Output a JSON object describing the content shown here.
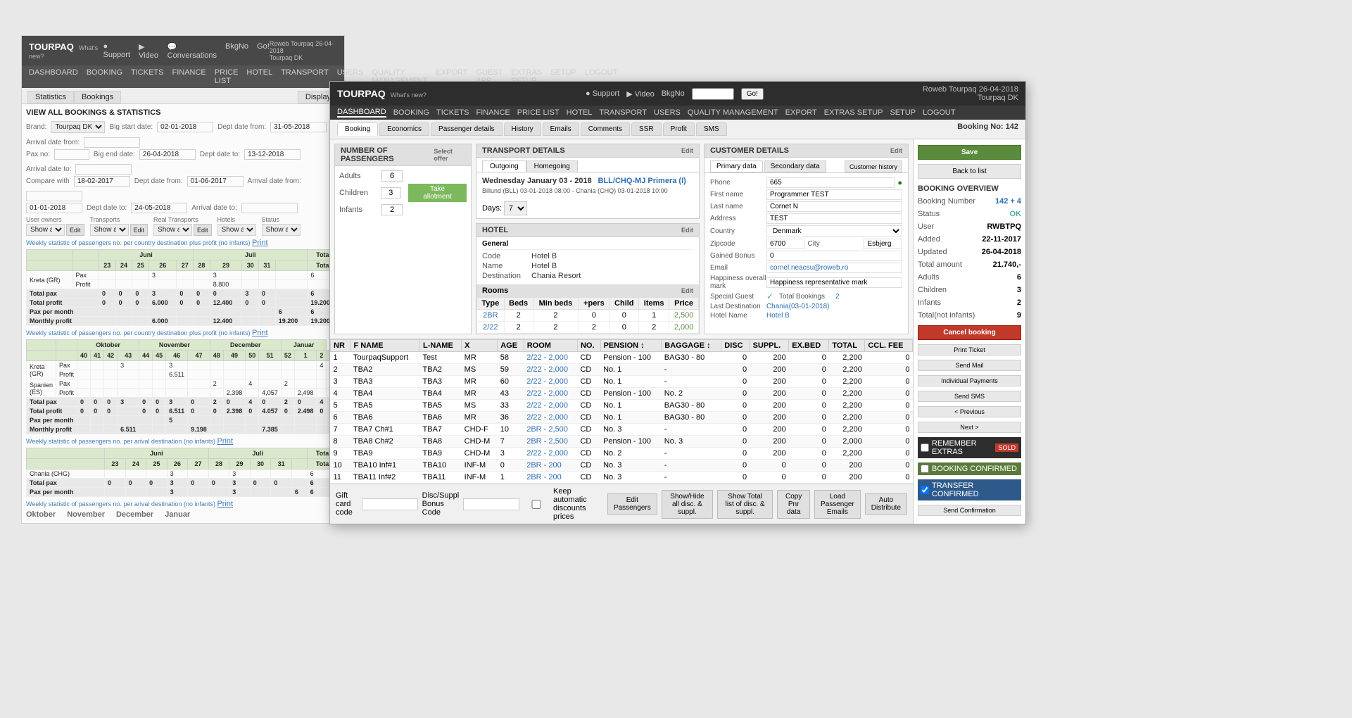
{
  "background_window": {
    "brand": "TOURPAQ",
    "brand_sub": "What's new?",
    "nav_items": [
      "DASHBOARD",
      "BOOKING",
      "TICKETS",
      "FINANCE",
      "PRICE LIST",
      "HOTEL",
      "TRANSPORT",
      "USERS",
      "QUALITY MANAGEMENT",
      "EXPORT",
      "GUEST APP",
      "EXTRAS SETUP",
      "SETUP",
      "LOGOUT"
    ],
    "title": "VIEW ALL BOOKINGS & STATISTICS",
    "tab_statistics": "Statistics",
    "tab_bookings": "Bookings",
    "tab_display": "Display",
    "filters": {
      "brand_label": "Brand",
      "brand_val": "Tourpaq DK",
      "pax_label": "Pax no:",
      "big_start_label": "Big start date:",
      "big_start_val": "02-01-2018",
      "dept_date_from_label": "Dept date from:",
      "dept_date_from_val": "31-05-2018",
      "arrival_date_from_label": "Arrival date from:",
      "big_end_label": "Big end date:",
      "big_end_val": "26-04-2018",
      "dept_date_to_label": "Dept date to:",
      "dept_date_to_val": "13-12-2018",
      "arrival_date_to_label": "Arrival date to:",
      "compare_label": "Compare with",
      "big_start2_val": "18-02-2017",
      "dept_date_from2_val": "01-06-2017",
      "arrival_date_from2_label": "Arrival date from:",
      "big_end2_val": "01-01-2018",
      "dept_date_to2_val": "24-05-2018",
      "arrival_date_to2_label": "Arrival date to:"
    },
    "sections": {
      "user_owners": "User owners",
      "transports": "Transports",
      "real_transports": "Real Transports",
      "hotels": "Hotels",
      "status": "Status"
    },
    "weekly_stat_1": "Weekly statistic of passengers no. per country destination plus profit (no infants) Print",
    "monthly_table_1": {
      "months": [
        "Juni",
        "Juli"
      ],
      "cols": [
        "23",
        "24",
        "25",
        "26",
        "27",
        "28",
        "29",
        "30",
        "31",
        "Total"
      ],
      "rows": [
        {
          "label": "Kreta (GR)",
          "type": "Pax",
          "values": [
            "",
            "",
            "",
            "3",
            "",
            "",
            "3",
            "",
            "",
            "6"
          ]
        },
        {
          "label": "",
          "type": "Profit",
          "values": [
            "",
            "",
            "",
            "",
            "",
            "",
            "8.800",
            "",
            "",
            ""
          ]
        },
        {
          "label": "Total pax",
          "values": [
            "0",
            "0",
            "0",
            "3",
            "0",
            "0",
            "0",
            "3",
            "0",
            "6"
          ]
        },
        {
          "label": "Total profit",
          "values": [
            "0",
            "0",
            "0",
            "6.000",
            "0",
            "0",
            "12.400",
            "0",
            "0",
            "19.200"
          ]
        },
        {
          "label": "Pax per month",
          "values": [
            "",
            "",
            "",
            "",
            "",
            "",
            "",
            "",
            "",
            "6"
          ]
        },
        {
          "label": "Monthly profit",
          "values": [
            "",
            "",
            "",
            "6.000",
            "",
            "",
            "12.400",
            "",
            "",
            "19.200"
          ]
        }
      ]
    },
    "weekly_stat_2": "Weekly statistic of passengers no. per country destination plus profit (no infants) Print",
    "monthly_table_2_months": [
      "Oktober",
      "November",
      "December",
      "Januar"
    ],
    "weekly_stat_3": "Weekly statistic of passengers no. per arival destination (no infants) Print"
  },
  "main_window": {
    "brand": "TOURPAQ",
    "brand_sub": "What's new?",
    "nav_items": [
      "DASHBOARD",
      "BOOKING",
      "TICKETS",
      "FINANCE",
      "PRICE LIST",
      "HOTEL",
      "TRANSPORT",
      "USERS",
      "QUALITY MANAGEMENT",
      "EXPORT",
      "EXTRAS SETUP",
      "SETUP",
      "LOGOUT"
    ],
    "user_info": "Roweb Tourpaq 26-04-2018",
    "user_company": "Tourpaq DK",
    "country": "Tourpaq DK",
    "search_placeholder": "Tourpaq DK",
    "booking_tabs": [
      "Booking",
      "Economics",
      "Passenger details",
      "History",
      "Emails",
      "Comments",
      "SSR",
      "Profit",
      "SMS"
    ],
    "booking_num_label": "Booking No: 142",
    "sections": {
      "number_of_passengers": "NUMBER OF PASSENGERS",
      "transport_details": "TRANSPORT DETAILS",
      "hotel": "HOTEL",
      "customer_details": "CUSTOMER DETAILS",
      "booking_overview": "BOOKING OVERVIEW"
    },
    "passengers": {
      "adults_label": "Adults",
      "adults_val": "6",
      "children_label": "Children",
      "children_val": "3",
      "infants_label": "Infants",
      "infants_val": "2",
      "take_allotment": "Take allotment"
    },
    "transport": {
      "tab_outgoing": "Outgoing",
      "tab_homegoing": "Homegoing",
      "route": "Wednesday January 03 - 2018",
      "route_code": "BLL/CHQ-MJ Primera (I)",
      "detail": "Billund (BLL) 03-01-2018 08:00 - Chania (CHQ) 03-01-2018 10:00",
      "days_label": "Days:",
      "days_val": "7"
    },
    "hotel": {
      "general_tab": "General",
      "code_label": "Code",
      "code_val": "Hotel B",
      "name_label": "Name",
      "name_val": "Hotel B",
      "destination_label": "Destination",
      "destination_val": "Chania Resort",
      "rooms_label": "Rooms",
      "rooms_cols": [
        "Type",
        "Beds",
        "Min beds",
        "+pers",
        "Child",
        "Items",
        "Price"
      ],
      "rooms_rows": [
        {
          "type": "2BR",
          "beds": "2",
          "min": "2",
          "plus": "0",
          "child": "0",
          "items": "1",
          "price": "2,500"
        },
        {
          "type": "2/22",
          "beds": "2",
          "min": "2",
          "plus": "2",
          "child": "0",
          "items": "2",
          "price": "2,000"
        }
      ]
    },
    "customer": {
      "tabs": [
        "Primary data",
        "Secondary data"
      ],
      "customer_history_btn": "Customer history",
      "phone_label": "Phone",
      "phone_val": "665",
      "first_name_label": "First name",
      "first_name_val": "Programmer TEST",
      "last_name_label": "Last name",
      "last_name_val": "Cornet N",
      "address_label": "Address",
      "address_val": "TEST",
      "country_label": "Country",
      "country_val": "Denmark",
      "zipcode_label": "Zipcode",
      "zipcode_val": "6700",
      "city_label": "City",
      "city_val": "Esbjerg",
      "gained_bonus_label": "Gained Bonus",
      "gained_bonus_val": "0",
      "email_label": "Email",
      "email_val": "cornel.neacsu@roweb.ro",
      "happiness_label": "Happiness overall mark",
      "happiness_val": "Happiness representative mark",
      "special_guest_label": "Special Guest",
      "special_guest_val": "✓",
      "total_bookings_label": "Total Bookings",
      "total_bookings_val": "2",
      "last_dest_label": "Last Destination",
      "last_dest_val": "Chania(03-01-2018)",
      "hotel_name_label": "Hotel Name",
      "hotel_name_val": "Hotel B"
    },
    "booking_overview": {
      "title": "BOOKING OVERVIEW",
      "booking_num_label": "Booking Number",
      "booking_num_val": "142 + 4",
      "status_label": "Status",
      "status_val": "OK",
      "user_label": "User",
      "user_val": "RWBTPQ",
      "added_label": "Added",
      "added_val": "22-11-2017",
      "updated_label": "Updated",
      "updated_val": "26-04-2018",
      "total_amount_label": "Total amount",
      "total_amount_val": "21.740,-",
      "adults_label": "Adults",
      "adults_val": "6",
      "children_label": "Children",
      "children_val": "3",
      "infants_label": "Infants",
      "infants_val": "2",
      "total_no_infants_label": "Total(not infants)",
      "total_no_infants_val": "9",
      "save_btn": "Save",
      "back_to_list_btn": "Back to list",
      "cancel_btn": "Cancel booking",
      "print_ticket_btn": "Print Ticket",
      "send_mail_btn": "Send Mail",
      "individual_payments_btn": "Individual Payments",
      "send_sms_btn": "Send SMS",
      "prev_btn": "< Previous",
      "next_btn": "Next >",
      "send_confirmation_btn": "Send Confirmation",
      "remember_extras_label": "REMEMBER EXTRAS",
      "remember_extras_sold": "SOLD",
      "booking_confirmed_label": "BOOKING CONFIRMED",
      "transfer_confirmed_label": "TRANSFER CONFIRMED"
    },
    "passenger_table": {
      "cols": [
        "NR",
        "F NAME",
        "L-NAME",
        "X",
        "AGE",
        "ROOM",
        "NO.",
        "PENSION",
        "BAGGAGE",
        "DISC",
        "SUPPL.",
        "EX.BED",
        "TOTAL",
        "CCL. FEE"
      ],
      "rows": [
        {
          "nr": "1",
          "fname": "TourpaqSupport",
          "lname": "Test",
          "x": "MR",
          "age": "58",
          "room": "2/22 - 2,000",
          "no": "CD",
          "pension": "Pension - 100",
          "baggage": "BAG30 - 80",
          "disc": "0",
          "suppl": "200",
          "exbed": "0",
          "total": "2,200",
          "ccl": "0"
        },
        {
          "nr": "2",
          "fname": "TBA2",
          "lname": "TBA2",
          "x": "MS",
          "age": "59",
          "room": "2/22 - 2,000",
          "no": "CD",
          "pension": "No. 1",
          "baggage": "-",
          "disc": "0",
          "suppl": "200",
          "exbed": "0",
          "total": "2,200",
          "ccl": "0"
        },
        {
          "nr": "3",
          "fname": "TBA3",
          "lname": "TBA3",
          "x": "MR",
          "age": "60",
          "room": "2/22 - 2,000",
          "no": "CD",
          "pension": "No. 1",
          "baggage": "-",
          "disc": "0",
          "suppl": "200",
          "exbed": "0",
          "total": "2,200",
          "ccl": "0"
        },
        {
          "nr": "4",
          "fname": "TBA4",
          "lname": "TBA4",
          "x": "MR",
          "age": "43",
          "room": "2/22 - 2,000",
          "no": "CD",
          "pension": "Pension - 100",
          "baggage": "No. 2",
          "disc": "0",
          "suppl": "200",
          "exbed": "0",
          "total": "2,200",
          "ccl": "0"
        },
        {
          "nr": "5",
          "fname": "TBA5",
          "lname": "TBA5",
          "x": "MS",
          "age": "33",
          "room": "2/22 - 2,000",
          "no": "CD",
          "pension": "No. 1",
          "baggage": "BAG30 - 80",
          "disc": "0",
          "suppl": "200",
          "exbed": "0",
          "total": "2,200",
          "ccl": "0"
        },
        {
          "nr": "6",
          "fname": "TBA6",
          "lname": "TBA6",
          "x": "MR",
          "age": "36",
          "room": "2/22 - 2,000",
          "no": "CD",
          "pension": "No. 1",
          "baggage": "BAG30 - 80",
          "disc": "0",
          "suppl": "200",
          "exbed": "0",
          "total": "2,200",
          "ccl": "0"
        },
        {
          "nr": "7",
          "fname": "TBA7 Ch#1",
          "lname": "TBA7",
          "x": "CHD-F",
          "age": "10",
          "room": "2BR - 2,500",
          "no": "CD",
          "pension": "No. 3",
          "baggage": "-",
          "disc": "0",
          "suppl": "200",
          "exbed": "0",
          "total": "2,200",
          "ccl": "0"
        },
        {
          "nr": "8",
          "fname": "TBA8 Ch#2",
          "lname": "TBA8",
          "x": "CHD-M",
          "age": "7",
          "room": "2BR - 2,500",
          "no": "CD",
          "pension": "Pension - 100",
          "baggage": "No. 3",
          "disc": "0",
          "suppl": "200",
          "exbed": "0",
          "total": "2,000",
          "ccl": "0"
        },
        {
          "nr": "9",
          "fname": "TBA9",
          "lname": "TBA9",
          "x": "CHD-M",
          "age": "3",
          "room": "2/22 - 2,000",
          "no": "CD",
          "pension": "No. 2",
          "baggage": "-",
          "disc": "0",
          "suppl": "200",
          "exbed": "0",
          "total": "2,200",
          "ccl": "0"
        },
        {
          "nr": "10",
          "fname": "TBA10 Inf#1",
          "lname": "TBA10",
          "x": "INF-M",
          "age": "0",
          "room": "2BR - 200",
          "no": "CD",
          "pension": "No. 3",
          "baggage": "-",
          "disc": "0",
          "suppl": "0",
          "exbed": "0",
          "total": "200",
          "ccl": "0"
        },
        {
          "nr": "11",
          "fname": "TBA11 Inf#2",
          "lname": "TBA11",
          "x": "INF-M",
          "age": "1",
          "room": "2BR - 200",
          "no": "CD",
          "pension": "No. 3",
          "baggage": "-",
          "disc": "0",
          "suppl": "0",
          "exbed": "0",
          "total": "200",
          "ccl": "0"
        }
      ]
    },
    "bottom_toolbar": {
      "gift_card_label": "Gift card code",
      "discount_label": "Disc/Suppl Bonus Code",
      "keep_automatic_label": "Keep automatic discounts prices",
      "edit_passengers_btn": "Edit Passengers",
      "show_hide_btn": "Show/Hide all disc. & suppl.",
      "show_total_btn": "Show Total list of disc. & suppl.",
      "copy_pnr_btn": "Copy Pnr data",
      "load_emails_btn": "Load Passenger Emails",
      "auto_distribute_btn": "Auto Distribute"
    }
  }
}
